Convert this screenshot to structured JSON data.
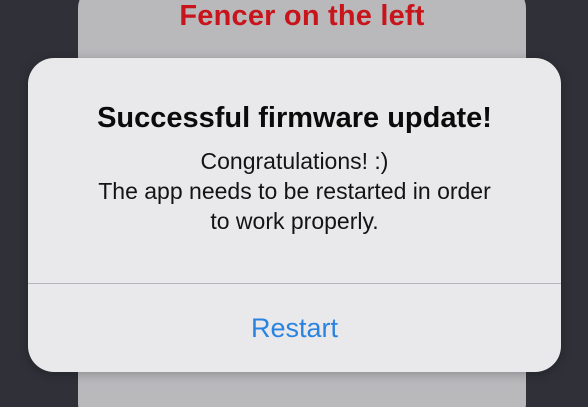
{
  "background_sheet": {
    "title": "Fencer on the left"
  },
  "alert": {
    "title": "Successful firmware update!",
    "message_lines": [
      "Congratulations! :)",
      "The app needs to be restarted in order",
      "to work properly."
    ],
    "button_label": "Restart"
  },
  "colors": {
    "accent_red": "#c8141b",
    "button_blue": "#2a83e0",
    "backdrop": "#2f3038"
  }
}
